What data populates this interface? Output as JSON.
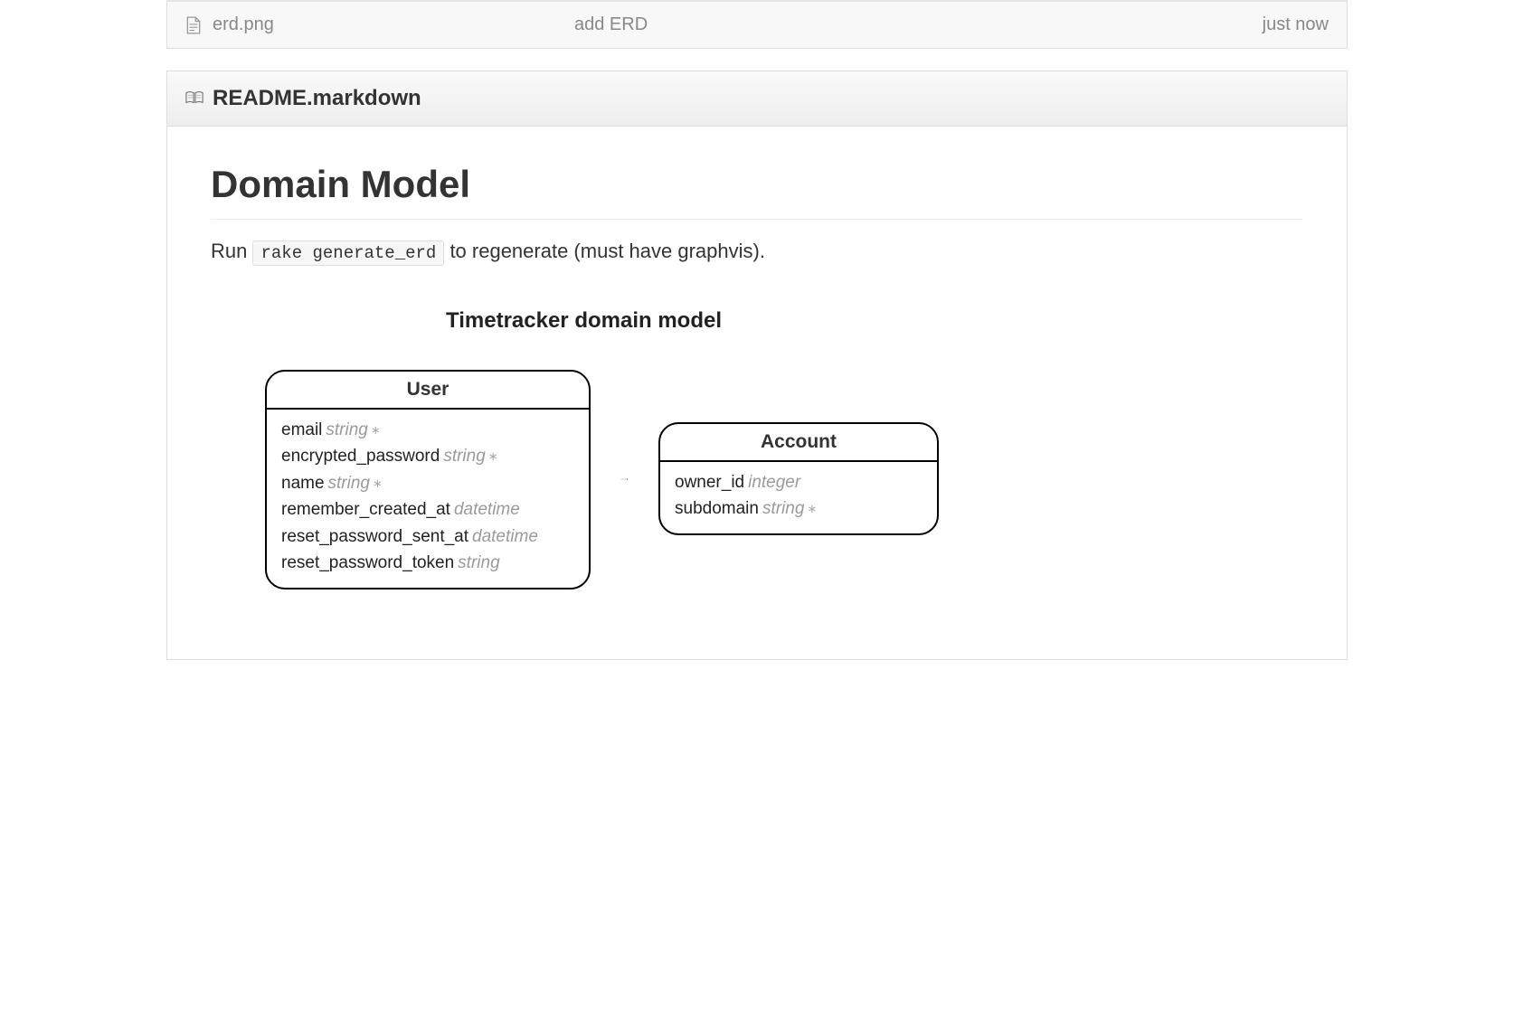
{
  "file_row": {
    "file_name": "erd.png",
    "commit_message": "add ERD",
    "time": "just now"
  },
  "readme": {
    "file_label": "README.markdown",
    "heading": "Domain Model",
    "run_prefix": "Run ",
    "run_code": "rake generate_erd",
    "run_suffix": " to regenerate (must have graphvis)."
  },
  "erd": {
    "title": "Timetracker domain model",
    "entities": {
      "user": {
        "name": "User",
        "attrs": [
          {
            "name": "email",
            "type": "string",
            "dot": "∗"
          },
          {
            "name": "encrypted_password",
            "type": "string",
            "dot": "∗"
          },
          {
            "name": "name",
            "type": "string",
            "dot": "∗"
          },
          {
            "name": "remember_created_at",
            "type": "datetime",
            "dot": ""
          },
          {
            "name": "reset_password_sent_at",
            "type": "datetime",
            "dot": ""
          },
          {
            "name": "reset_password_token",
            "type": "string",
            "dot": ""
          }
        ]
      },
      "account": {
        "name": "Account",
        "attrs": [
          {
            "name": "owner_id",
            "type": "integer",
            "dot": ""
          },
          {
            "name": "subdomain",
            "type": "string",
            "dot": "∗"
          }
        ]
      }
    }
  }
}
